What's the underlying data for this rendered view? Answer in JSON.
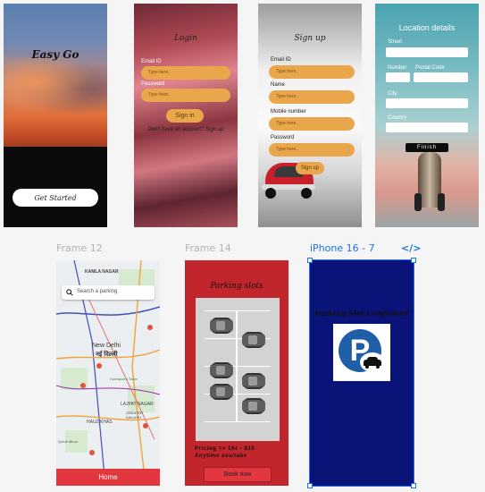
{
  "splash": {
    "title": "Easy Go",
    "cta": "Get Started"
  },
  "login": {
    "title": "Login",
    "email_label": "Email ID",
    "email_placeholder": "Type here..",
    "password_label": "Password",
    "password_placeholder": "Type here..",
    "signin": "Sign in",
    "footer": "Don't have an account? Sign up"
  },
  "signup": {
    "title": "Sign up",
    "fields": [
      {
        "label": "Email ID",
        "placeholder": "Type here.."
      },
      {
        "label": "Name",
        "placeholder": "Type here.."
      },
      {
        "label": "Mobile number",
        "placeholder": "Type here.."
      },
      {
        "label": "Password",
        "placeholder": "Type here.."
      }
    ],
    "button": "Sign up"
  },
  "location": {
    "title": "Location details",
    "street": "Street",
    "number": "Number",
    "postal": "Postal Code",
    "city": "City",
    "country": "Country",
    "finish": "Finish"
  },
  "frames": {
    "frame12": "Frame 12",
    "frame14": "Frame 14",
    "iphone": "iPhone 16 - 7",
    "code_icon": "</>"
  },
  "map": {
    "search_placeholder": "Search a parking",
    "places": [
      "KAMLA NAGAR",
      "New Delhi",
      "नई दिल्ली",
      "Humayun's Tomb",
      "LAJPAT NAGAR",
      "GREATER KAILASH",
      "HAUZ KHAS",
      "Qutub Minar"
    ],
    "home": "Home"
  },
  "slots": {
    "title": "Parking slots",
    "pricing": "Pricing => 1hr - $10",
    "availability": "Anytime availabe",
    "book": "Book now"
  },
  "confirm": {
    "title": "Parking Slot Confirmed",
    "logo_letter": "P"
  },
  "colors": {
    "accent": "#eaa64a",
    "brand_red": "#c0262b",
    "navy": "#0a1478",
    "selection": "#1a73e8",
    "home_red": "#e2373f"
  }
}
